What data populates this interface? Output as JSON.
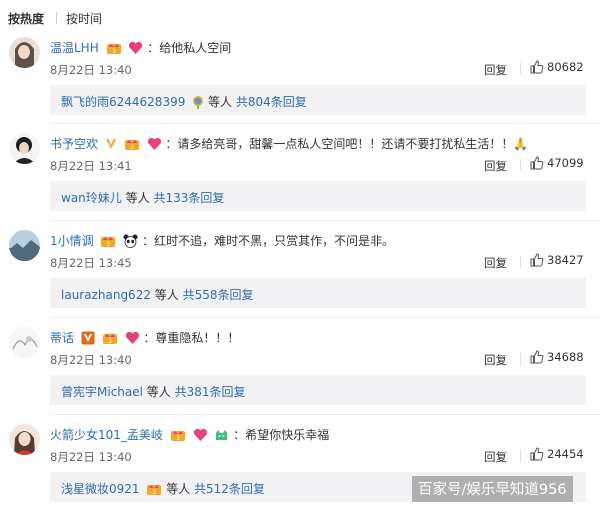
{
  "tabs": {
    "hot": "按热度",
    "time": "按时间"
  },
  "comments": [
    {
      "user": "温温LHH",
      "text": "：给他私人空间",
      "time": "8月22日 13:40",
      "reply": "回复",
      "likes": "80682",
      "sub": {
        "user": "飘飞的雨6244628399",
        "mid": " 等人 ",
        "total": "共804条回复"
      }
    },
    {
      "user": "书予空欢",
      "text": "：请多给亮哥，甜馨一点私人空间吧！！还请不要打扰私生活！！🙏",
      "time": "8月22日 13:41",
      "reply": "回复",
      "likes": "47099",
      "sub": {
        "user": "wan玲妹儿",
        "mid": " 等人 ",
        "total": "共133条回复"
      }
    },
    {
      "user": "1小情调",
      "text": "：红时不追，难时不黑，只赏其作，不问是非。",
      "time": "8月22日 13:45",
      "reply": "回复",
      "likes": "38427",
      "sub": {
        "user": "laurazhang622",
        "mid": " 等人 ",
        "total": "共558条回复"
      }
    },
    {
      "user": "蒂话",
      "text": "：尊重隐私！！！",
      "time": "8月22日 13:40",
      "reply": "回复",
      "likes": "34688",
      "sub": {
        "user": "曾宪宇Michael",
        "mid": " 等人 ",
        "total": "共381条回复"
      }
    },
    {
      "user": "火箭少女101_孟美岐",
      "text": "：希望你快乐幸福",
      "time": "8月22日 13:40",
      "reply": "回复",
      "likes": "24454",
      "sub": {
        "user": "浅星微妆0921",
        "mid": " 等人 ",
        "total": "共512条回复"
      }
    }
  ],
  "watermark": "百家号/娱乐早知道956",
  "icons": {
    "crown_badge": "crown-badge-icon",
    "heart_badge": "heart-badge-icon",
    "vip_badge": "vip-v-icon",
    "panda_badge": "panda-icon",
    "rainbow_badge": "rainbow-badge-icon",
    "like": "thumbs-up-icon"
  },
  "colors": {
    "link": "#2d6cb5",
    "sub_bg": "#f2f2f5",
    "heart": "#e8407a",
    "crown": "#f5a623"
  }
}
